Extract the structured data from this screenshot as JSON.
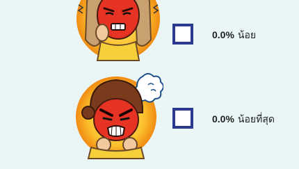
{
  "poll": {
    "options": [
      {
        "percent": "0.0%",
        "label": "น้อย",
        "emoji_icon": "annoyed-face-emoji-icon",
        "checked": false
      },
      {
        "percent": "0.0%",
        "label": "น้อยที่สุด",
        "emoji_icon": "angry-face-emoji-icon",
        "checked": false
      }
    ]
  },
  "colors": {
    "background": "#eaf6f6",
    "checkbox_border": "#2b3a8f",
    "emoji_ring": "#f7a21b",
    "face_red": "#e63323"
  }
}
